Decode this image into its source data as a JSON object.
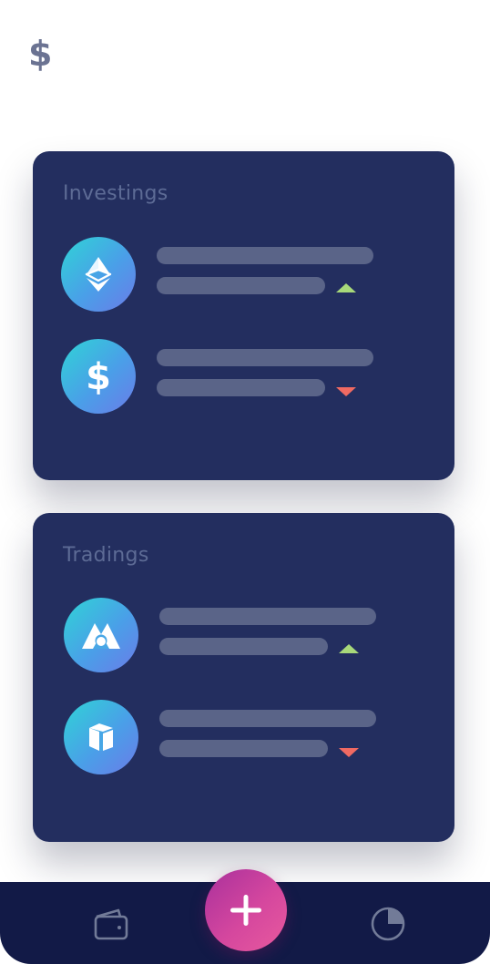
{
  "header": {
    "currency_symbol": "$"
  },
  "investings": {
    "title": "Investings",
    "items": [
      {
        "icon": "ethereum-classic-icon",
        "trend": "up"
      },
      {
        "icon": "dollar-icon",
        "trend": "down"
      }
    ]
  },
  "tradings": {
    "title": "Tradings",
    "items": [
      {
        "icon": "mithril-icon",
        "trend": "up"
      },
      {
        "icon": "neo-icon",
        "trend": "down"
      }
    ]
  },
  "bottom_nav": {
    "items": [
      "wallet-icon",
      "add-icon",
      "pie-chart-icon"
    ]
  },
  "colors": {
    "card_bg": "#232e5f",
    "nav_bg": "#121a47",
    "trend_up": "#a8d97a",
    "trend_down": "#f06a62",
    "accent": "#d5479e"
  }
}
